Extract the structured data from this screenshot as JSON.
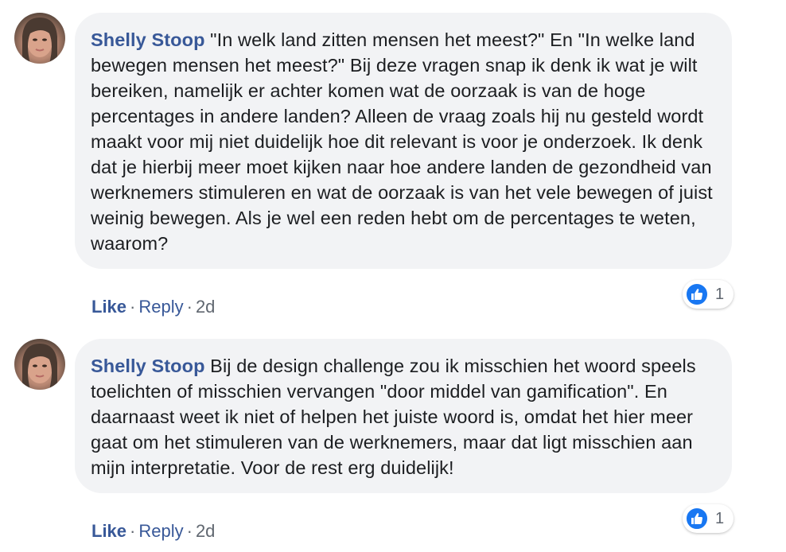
{
  "comments": [
    {
      "author": "Shelly Stoop",
      "text": "\"In welk land zitten mensen het meest?\" En \"In welke land bewegen mensen het meest?\" Bij deze vragen snap ik denk ik wat je wilt bereiken, namelijk er achter komen wat de oorzaak is van de hoge percentages in andere landen? Alleen de vraag zoals hij nu gesteld wordt maakt voor mij niet duidelijk hoe dit relevant is voor je onderzoek. Ik denk dat je hierbij meer moet kijken naar hoe andere landen de gezondheid van werknemers stimuleren en wat de oorzaak is van het vele bewegen of juist weinig bewegen. Als je wel een reden hebt om de percentages te weten, waarom?",
      "like_label": "Like",
      "reply_label": "Reply",
      "timestamp": "2d",
      "reaction_count": "1",
      "reaction_icon": "thumbs-up-icon"
    },
    {
      "author": "Shelly Stoop",
      "text": "Bij de design challenge zou ik misschien het woord speels toelichten of misschien vervangen \"door middel van gamification\". En daarnaast weet ik niet of helpen het juiste woord is, omdat het hier meer gaat om het stimuleren van de werknemers, maar dat ligt misschien aan mijn interpretatie. Voor de rest erg duidelijk!",
      "like_label": "Like",
      "reply_label": "Reply",
      "timestamp": "2d",
      "reaction_count": "1",
      "reaction_icon": "thumbs-up-icon"
    }
  ],
  "separator": "·",
  "colors": {
    "author": "#385898",
    "bubble_bg": "#f2f3f5",
    "like_badge": "#1877f2",
    "meta": "#606770"
  }
}
